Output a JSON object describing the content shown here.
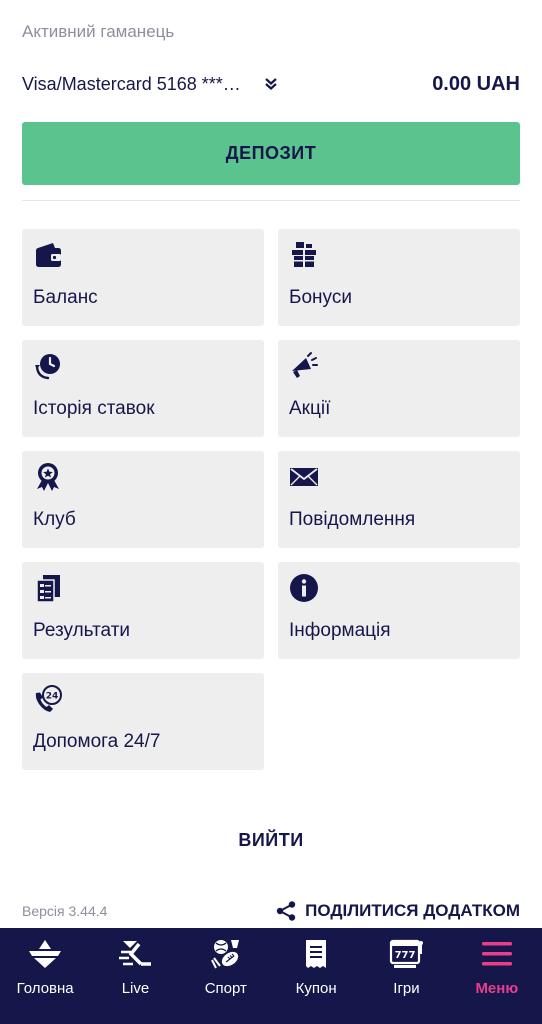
{
  "wallet": {
    "label": "Активний гаманець",
    "selected": "Visa/Mastercard 5168 ****...",
    "amount": "0.00 UAH"
  },
  "deposit_label": "ДЕПОЗИТ",
  "menu": [
    {
      "label": "Баланс",
      "icon": "wallet-icon"
    },
    {
      "label": "Бонуси",
      "icon": "gift-icon"
    },
    {
      "label": "Історія ставок",
      "icon": "history-icon"
    },
    {
      "label": "Акції",
      "icon": "megaphone-icon"
    },
    {
      "label": "Клуб",
      "icon": "award-badge-icon"
    },
    {
      "label": "Повідомлення",
      "icon": "envelope-icon"
    },
    {
      "label": "Результати",
      "icon": "documents-icon"
    },
    {
      "label": "Інформація",
      "icon": "info-icon"
    },
    {
      "label": "Допомога 24/7",
      "icon": "phone-24-icon"
    }
  ],
  "logout_label": "ВИЙТИ",
  "version": "Версія 3.44.4",
  "share_label": "ПОДІЛИТИСЯ ДОДАТКОМ",
  "nav": [
    {
      "label": "Головна",
      "icon": "home-logo-icon",
      "active": false
    },
    {
      "label": "Live",
      "icon": "live-runner-icon",
      "active": false
    },
    {
      "label": "Спорт",
      "icon": "sports-balls-icon",
      "active": false
    },
    {
      "label": "Купон",
      "icon": "receipt-icon",
      "active": false
    },
    {
      "label": "Ігри",
      "icon": "slot-machine-icon",
      "active": false
    },
    {
      "label": "Меню",
      "icon": "hamburger-menu-icon",
      "active": true
    }
  ],
  "colors": {
    "primary_dark": "#15174a",
    "accent_green": "#5bc38d",
    "accent_pink": "#e83e8c",
    "tile_bg": "#eeeeef",
    "muted_text": "#8e8f9c"
  }
}
